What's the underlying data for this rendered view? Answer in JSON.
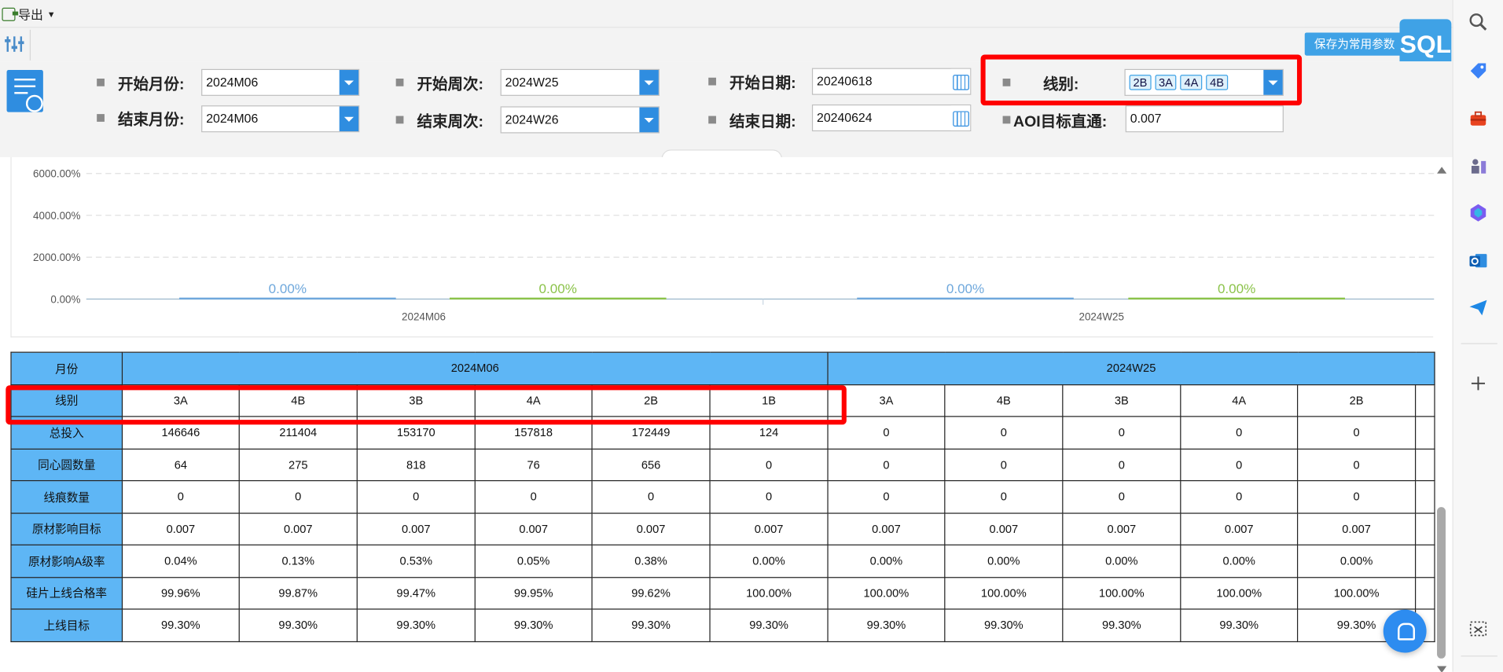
{
  "toolbar": {
    "export_label": "导出",
    "save_label": "保存为常用参数",
    "sql_label": "SQL"
  },
  "filters": {
    "start_month_label": "开始月份:",
    "start_month_value": "2024M06",
    "end_month_label": "结束月份:",
    "end_month_value": "2024M06",
    "start_week_label": "开始周次:",
    "start_week_value": "2024W25",
    "end_week_label": "结束周次:",
    "end_week_value": "2024W26",
    "start_date_label": "开始日期:",
    "start_date_value": "20240618",
    "end_date_label": "结束日期:",
    "end_date_value": "20240624",
    "line_label": "线别:",
    "line_tags": [
      "2B",
      "3A",
      "4A",
      "4B"
    ],
    "aoi_label": "AOI目标直通:",
    "aoi_value": "0.007"
  },
  "chart_data": {
    "type": "bar",
    "yticks": [
      "6000.00%",
      "4000.00%",
      "2000.00%",
      "0.00%"
    ],
    "ylim": [
      0,
      6000
    ],
    "categories": [
      "2024M06",
      "2024W25"
    ],
    "data_labels": [
      "0.00%",
      "0.00%",
      "0.00%",
      "0.00%"
    ],
    "series_colors": [
      "#6fa8dc",
      "#8bc34a"
    ],
    "grid": true
  },
  "table": {
    "row_headers": [
      "月份",
      "线别",
      "总投入",
      "同心圆数量",
      "线痕数量",
      "原材影响目标",
      "原材影响A级率",
      "硅片上线合格率",
      "上线目标"
    ],
    "groups": [
      "2024M06",
      "2024W25"
    ],
    "lines": [
      "3A",
      "4B",
      "3B",
      "4A",
      "2B",
      "1B",
      "3A",
      "4B",
      "3B",
      "4A",
      "2B"
    ],
    "rows": [
      [
        "146646",
        "211404",
        "153170",
        "157818",
        "172449",
        "124",
        "0",
        "0",
        "0",
        "0",
        "0"
      ],
      [
        "64",
        "275",
        "818",
        "76",
        "656",
        "0",
        "0",
        "0",
        "0",
        "0",
        "0"
      ],
      [
        "0",
        "0",
        "0",
        "0",
        "0",
        "0",
        "0",
        "0",
        "0",
        "0",
        "0"
      ],
      [
        "0.007",
        "0.007",
        "0.007",
        "0.007",
        "0.007",
        "0.007",
        "0.007",
        "0.007",
        "0.007",
        "0.007",
        "0.007"
      ],
      [
        "0.04%",
        "0.13%",
        "0.53%",
        "0.05%",
        "0.38%",
        "0.00%",
        "0.00%",
        "0.00%",
        "0.00%",
        "0.00%",
        "0.00%"
      ],
      [
        "99.96%",
        "99.87%",
        "99.47%",
        "99.95%",
        "99.62%",
        "100.00%",
        "100.00%",
        "100.00%",
        "100.00%",
        "100.00%",
        "100.00%"
      ],
      [
        "99.30%",
        "99.30%",
        "99.30%",
        "99.30%",
        "99.30%",
        "99.30%",
        "99.30%",
        "99.30%",
        "99.30%",
        "99.30%",
        "99.30%"
      ]
    ]
  },
  "sidebar_icons": [
    "search-icon",
    "tag-icon",
    "toolbox-icon",
    "chess-icon",
    "copilot-icon",
    "outlook-icon",
    "send-icon",
    "add-icon",
    "screenshot-icon"
  ]
}
